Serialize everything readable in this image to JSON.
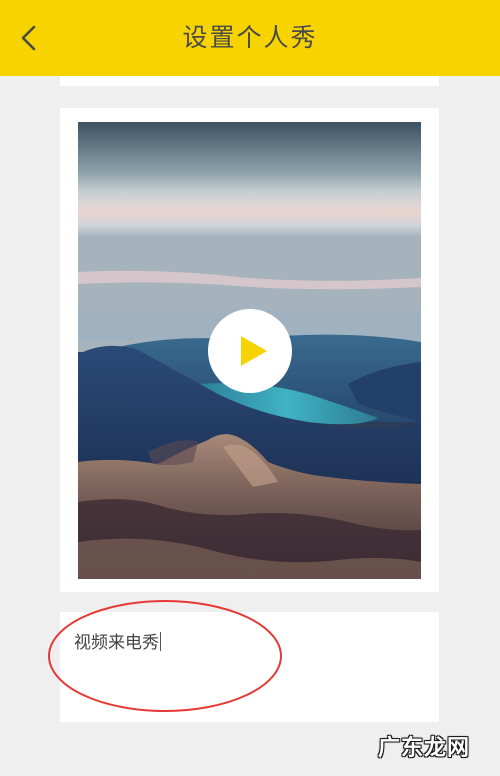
{
  "header": {
    "title": "设置个人秀",
    "back_icon": "chevron-left-icon",
    "background_color": "#f7d300"
  },
  "video": {
    "play_icon": "play-icon",
    "play_color": "#f7d300"
  },
  "input": {
    "value": "视频来电秀"
  },
  "annotation": {
    "color": "#e53935"
  },
  "watermark": {
    "text": "广东龙网"
  }
}
